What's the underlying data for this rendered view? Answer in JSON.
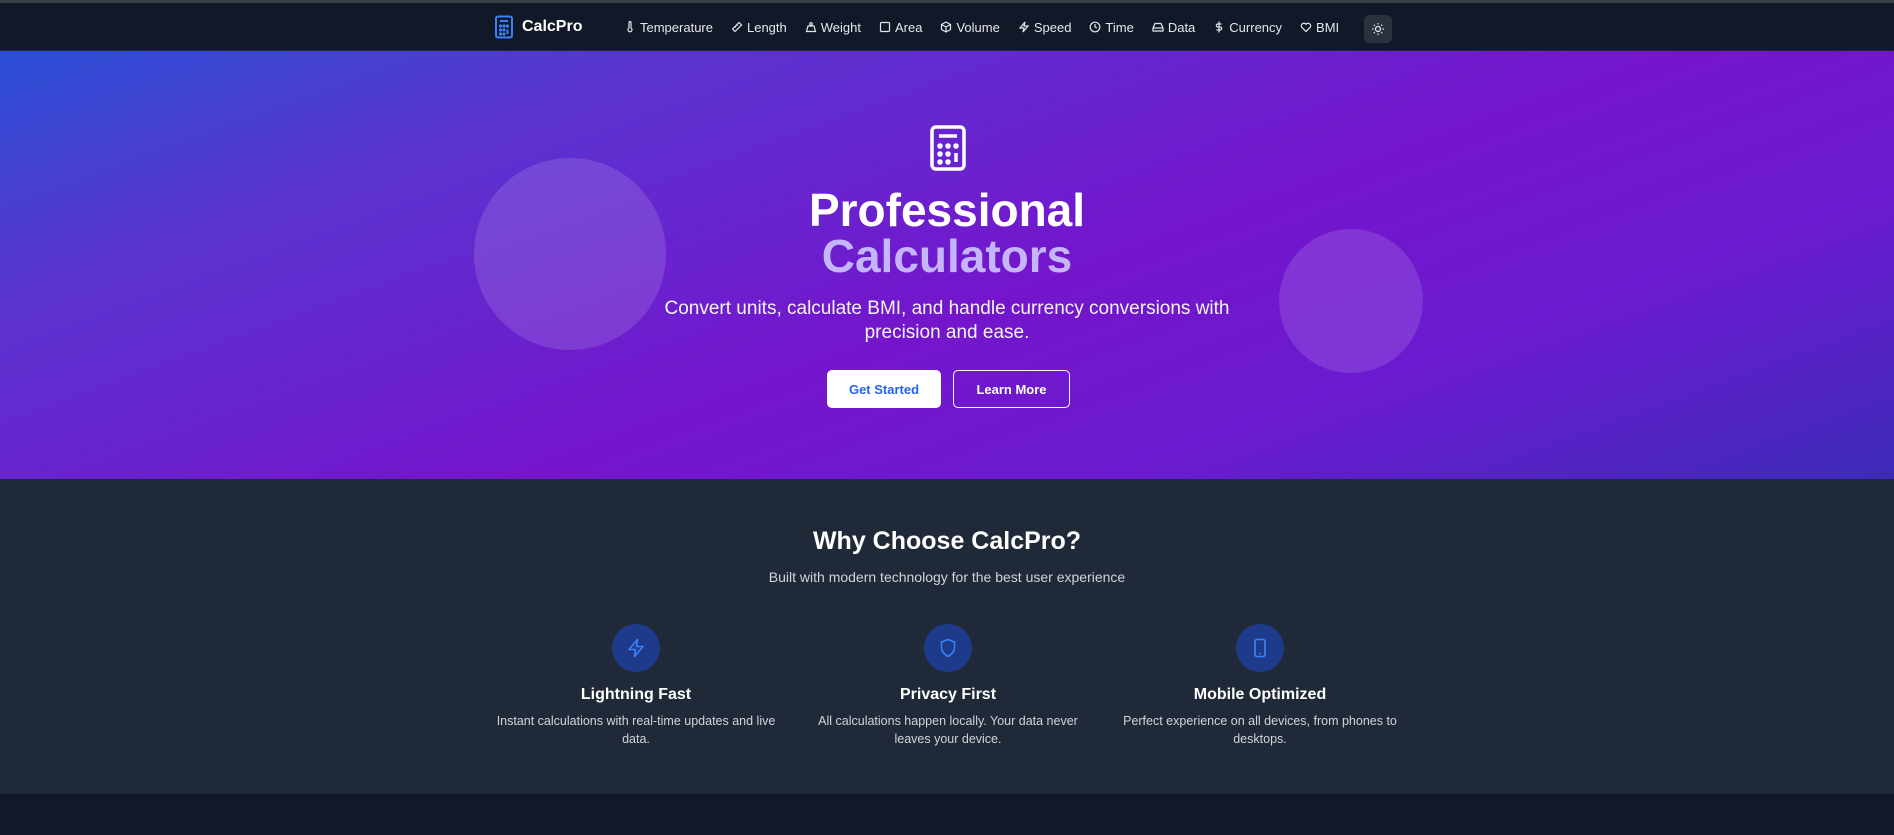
{
  "brand": {
    "name": "CalcPro",
    "accent": "#3b82f6"
  },
  "nav": {
    "items": [
      {
        "label": "Temperature",
        "icon": "thermometer-icon"
      },
      {
        "label": "Length",
        "icon": "ruler-icon"
      },
      {
        "label": "Weight",
        "icon": "weight-icon"
      },
      {
        "label": "Area",
        "icon": "square-icon"
      },
      {
        "label": "Volume",
        "icon": "box-icon"
      },
      {
        "label": "Speed",
        "icon": "zap-icon"
      },
      {
        "label": "Time",
        "icon": "clock-icon"
      },
      {
        "label": "Data",
        "icon": "hard-drive-icon"
      },
      {
        "label": "Currency",
        "icon": "dollar-icon"
      },
      {
        "label": "BMI",
        "icon": "heart-icon"
      }
    ],
    "theme_toggle_icon": "sun-icon"
  },
  "hero": {
    "icon": "calculator-icon",
    "title_line1": "Professional",
    "title_line2": "Calculators",
    "subtitle": "Convert units, calculate BMI, and handle currency conversions with precision and ease.",
    "primary_button": "Get Started",
    "secondary_button": "Learn More",
    "highlight_color": "#c4b5fd"
  },
  "features": {
    "title": "Why Choose CalcPro?",
    "subtitle": "Built with modern technology for the best user experience",
    "items": [
      {
        "icon": "zap-icon",
        "title": "Lightning Fast",
        "description": "Instant calculations with real-time updates and live data."
      },
      {
        "icon": "shield-icon",
        "title": "Privacy First",
        "description": "All calculations happen locally. Your data never leaves your device."
      },
      {
        "icon": "smartphone-icon",
        "title": "Mobile Optimized",
        "description": "Perfect experience on all devices, from phones to desktops."
      }
    ]
  }
}
